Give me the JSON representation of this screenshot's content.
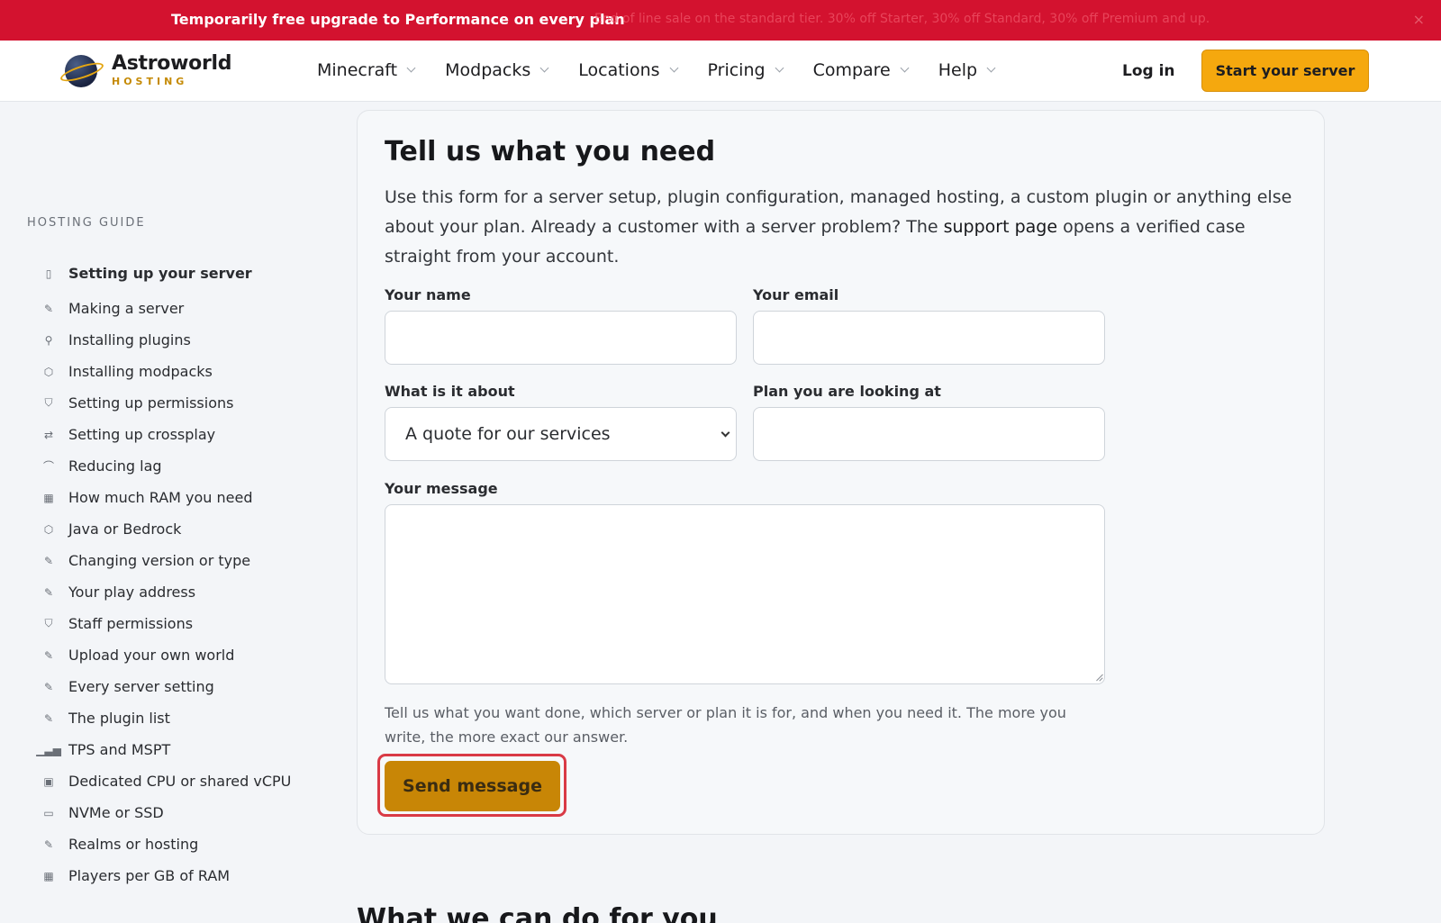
{
  "promo": {
    "headline": "Temporarily free upgrade to Performance on every plan",
    "details": "End of line sale on the standard tier. 30% off Starter, 30% off Standard, 30% off Premium and up.",
    "close": "×"
  },
  "nav": {
    "brand_name": "Astroworld",
    "brand_sub": "HOSTING",
    "menu": [
      {
        "label": "Minecraft"
      },
      {
        "label": "Modpacks"
      },
      {
        "label": "Locations"
      },
      {
        "label": "Pricing"
      },
      {
        "label": "Compare"
      },
      {
        "label": "Help"
      }
    ],
    "login": "Log in",
    "cta": "Start your server"
  },
  "sidebar": {
    "heading": "HOSTING GUIDE",
    "items": [
      {
        "label": "Setting up your server",
        "icon": "book-icon",
        "glyph": "▯"
      },
      {
        "label": "Making a server",
        "icon": "wrench-icon",
        "glyph": "✎"
      },
      {
        "label": "Installing plugins",
        "icon": "plug-icon",
        "glyph": "⚲"
      },
      {
        "label": "Installing modpacks",
        "icon": "cube-icon",
        "glyph": "⬡"
      },
      {
        "label": "Setting up permissions",
        "icon": "shield-icon",
        "glyph": "⛉"
      },
      {
        "label": "Setting up crossplay",
        "icon": "swap-icon",
        "glyph": "⇄"
      },
      {
        "label": "Reducing lag",
        "icon": "gauge-icon",
        "glyph": "⌒"
      },
      {
        "label": "How much RAM you need",
        "icon": "memory-icon",
        "glyph": "▦"
      },
      {
        "label": "Java or Bedrock",
        "icon": "cube-icon",
        "glyph": "⬡"
      },
      {
        "label": "Changing version or type",
        "icon": "wrench-icon",
        "glyph": "✎"
      },
      {
        "label": "Your play address",
        "icon": "wrench-icon",
        "glyph": "✎"
      },
      {
        "label": "Staff permissions",
        "icon": "shield-icon",
        "glyph": "⛉"
      },
      {
        "label": "Upload your own world",
        "icon": "wrench-icon",
        "glyph": "✎"
      },
      {
        "label": "Every server setting",
        "icon": "wrench-icon",
        "glyph": "✎"
      },
      {
        "label": "The plugin list",
        "icon": "wrench-icon",
        "glyph": "✎"
      },
      {
        "label": "TPS and MSPT",
        "icon": "bar-chart-icon",
        "glyph": "▁▃▅"
      },
      {
        "label": "Dedicated CPU or shared vCPU",
        "icon": "cpu-icon",
        "glyph": "▣"
      },
      {
        "label": "NVMe or SSD",
        "icon": "drive-icon",
        "glyph": "▭"
      },
      {
        "label": "Realms or hosting",
        "icon": "wrench-icon",
        "glyph": "✎"
      },
      {
        "label": "Players per GB of RAM",
        "icon": "memory-icon",
        "glyph": "▦"
      }
    ]
  },
  "form": {
    "title": "Tell us what you need",
    "intro_before": "Use this form for a server setup, plugin configuration, managed hosting, a custom plugin or anything else about your plan. Already a customer with a server problem? The ",
    "intro_link": "support page",
    "intro_after": " opens a verified case straight from your account.",
    "name_label": "Your name",
    "name_value": "",
    "email_label": "Your email",
    "email_value": "",
    "topic_label": "What is it about",
    "topic_value": "A quote for our services",
    "plan_label": "Plan you are looking at",
    "plan_value": "",
    "message_label": "Your message",
    "message_value": "",
    "help": "Tell us what you want done, which server or plan it is for, and when you need it. The more you write, the more exact our answer.",
    "submit": "Send message"
  },
  "next_section": {
    "title": "What we can do for you"
  },
  "colors": {
    "promo_bg": "#d3122f",
    "cta": "#f5a80e",
    "submit": "#c88606",
    "focus_ring": "#d93a45"
  }
}
